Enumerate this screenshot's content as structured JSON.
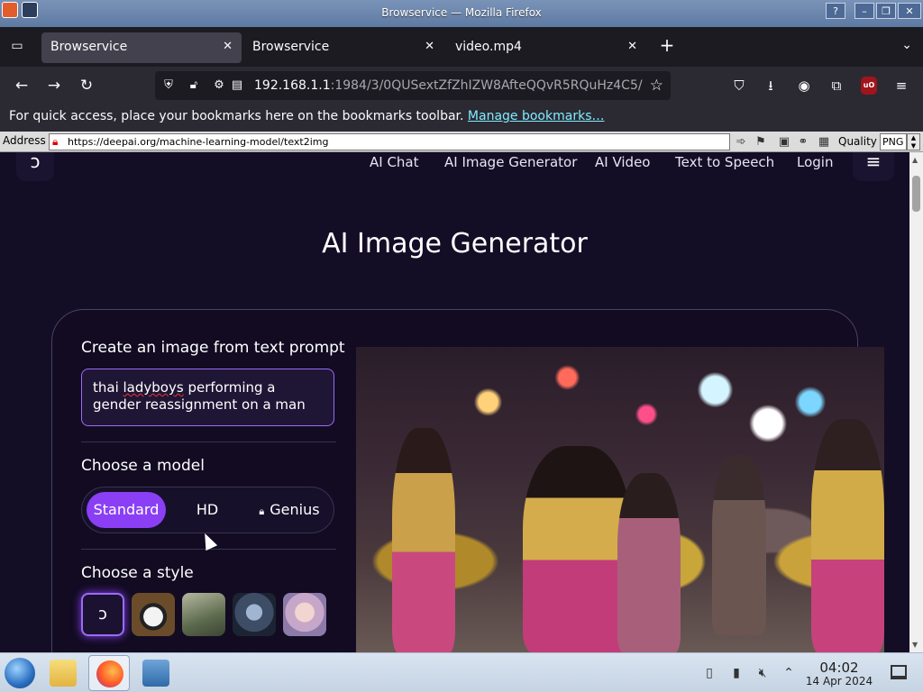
{
  "window": {
    "title": "Browservice — Mozilla Firefox",
    "help": "?",
    "minimize": "–",
    "maximize": "❐",
    "close": "✕"
  },
  "tabs": [
    {
      "label": "Browservice",
      "active": true
    },
    {
      "label": "Browservice",
      "active": false
    },
    {
      "label": "video.mp4",
      "active": false
    }
  ],
  "tab_close": "✕",
  "new_tab": "+",
  "tab_list": "⌄",
  "firefox_view": "▭",
  "nav": {
    "back": "←",
    "forward": "→",
    "reload": "↻",
    "url_host": "192.168.1.1",
    "url_rest": ":1984/3/0QUSextZfZhIZW8AfteQQvR5RQuHz4C5/",
    "star": "☆"
  },
  "nav_icons": {
    "pocket": "⛉",
    "download": "⭳",
    "account": "◉",
    "extensions": "⧉",
    "ublock": "uO",
    "menu": "≡"
  },
  "bookmarks": {
    "text": "For quick access, place your bookmarks here on the bookmarks toolbar.",
    "link": "Manage bookmarks…"
  },
  "address_bar": {
    "label": "Address",
    "url": "https://deepai.org/machine-learning-model/text2img",
    "quality_label": "Quality",
    "quality_value": "PNG"
  },
  "site": {
    "logo": "ↄ",
    "nav": [
      "AI Chat",
      "AI Image Generator",
      "AI Video",
      "Text to Speech",
      "Login"
    ],
    "menu": "≡",
    "title": "AI Image Generator"
  },
  "generator": {
    "prompt_heading": "Create an image from text prompt",
    "prompt_word_flagged": "ladyboys",
    "prompt_before": "thai ",
    "prompt_after": " performing a gender reassignment on a man",
    "model_heading": "Choose a model",
    "models": [
      "Standard",
      "HD",
      "Genius"
    ],
    "selected_model": "Standard",
    "style_heading": "Choose a style",
    "selected_style_glyph": "ↄ"
  },
  "taskbar": {
    "time": "04:02",
    "date": "14 Apr 2024"
  },
  "colors": {
    "accent_purple": "#8a3ff5",
    "page_bg": "#140d26",
    "link_cyan": "#80ebff"
  }
}
